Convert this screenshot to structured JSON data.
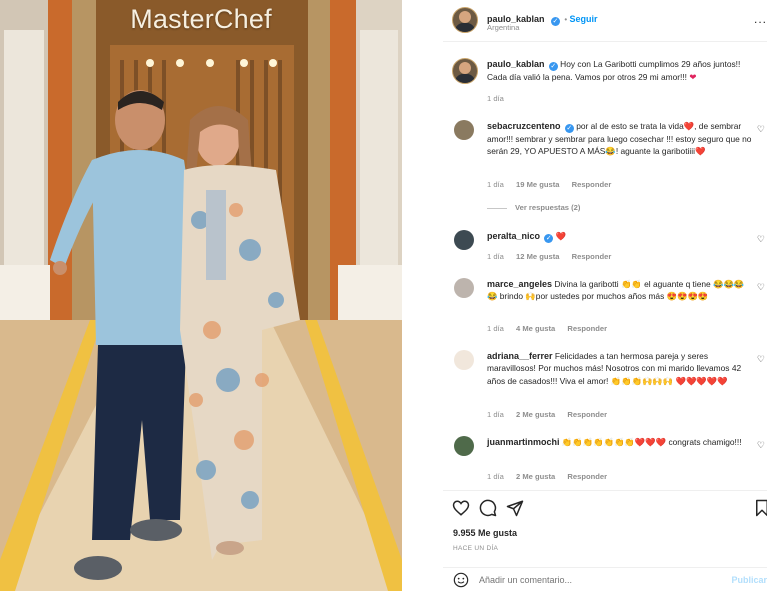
{
  "photo": {
    "sign_text": "MasterChef"
  },
  "post": {
    "username": "paulo_kablan",
    "follow_label": "Seguir",
    "location": "Argentina",
    "more_label": "...",
    "caption_user": "paulo_kablan",
    "caption_text": "Hoy con La Garibotti cumplimos 29 años juntos!! Cada día valió la pena. Vamos por otros 29 mi amor!!!",
    "caption_time": "1 día"
  },
  "comments": [
    {
      "user": "sebacruzcenteno",
      "text": "por al de esto se trata la vida❤️, de sembrar amor!!! sembrar y sembrar para luego cosechar !!! estoy seguro que no serán 29, YO APUESTO A MÁS😂! aguante la garibotiiii❤️",
      "time": "1 día",
      "likes": "19 Me gusta",
      "reply": "Responder",
      "view_replies": "Ver respuestas (2)"
    },
    {
      "user": "peralta_nico",
      "text": "❤️",
      "time": "1 día",
      "likes": "12 Me gusta",
      "reply": "Responder"
    },
    {
      "user": "marce_angeles",
      "text": "Divina la garibotti 👏👏 el aguante q tiene 😂😂😂😂 brindo 🙌por ustedes por muchos años más 😍😍😍😍",
      "time": "1 día",
      "likes": "4 Me gusta",
      "reply": "Responder"
    },
    {
      "user": "adriana__ferrer",
      "text": "Felicidades a tan hermosa pareja y seres maravillosos! Por muchos más! Nosotros con mi marido llevamos 42 años de casados!!! Viva el amor! 👏👏👏🙌🙌🙌 ❤️❤️❤️❤️❤️",
      "time": "1 día",
      "likes": "2 Me gusta",
      "reply": "Responder"
    },
    {
      "user": "juanmartinmochi",
      "text": "👏👏👏👏👏👏👏❤️❤️❤️ congrats chamigo!!!",
      "time": "1 día",
      "likes": "2 Me gusta",
      "reply": "Responder"
    }
  ],
  "footer": {
    "likes_count": "9.955 Me gusta",
    "time_ago": "HACE UN DÍA",
    "comment_placeholder": "Añadir un comentario...",
    "publish_label": "Publicar"
  },
  "colors": {
    "link_blue": "#0095f6",
    "verified_blue": "#3897f0",
    "heart_red": "#e0245e"
  }
}
